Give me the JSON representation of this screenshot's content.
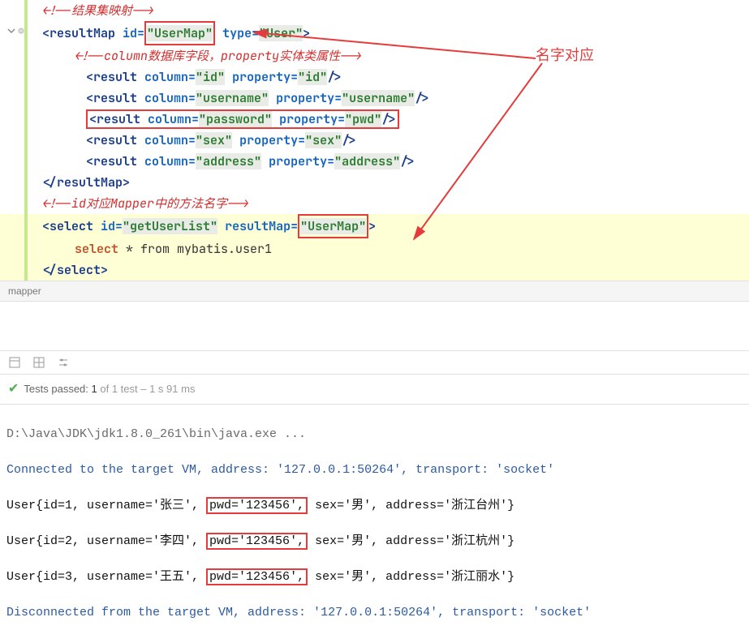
{
  "annotation_label": "名字对应",
  "code": {
    "c1": "<!--结果集映射-->",
    "rm_open1": "<",
    "rm_tag": "resultMap",
    "rm_id_attr": " id=",
    "rm_id_val": "\"UserMap\"",
    "rm_type_attr": " type=",
    "rm_type_val": "\"User\"",
    "rm_close": ">",
    "c2": "<!--column数据库字段，property实体类属性-->",
    "r_tag": "result",
    "col_attr": " column=",
    "prop_attr": " property=",
    "r1_col": "\"id\"",
    "r1_prop": "\"id\"",
    "r2_col": "\"username\"",
    "r2_prop": "\"username\"",
    "r3_col": "\"password\"",
    "r3_prop": "\"pwd\"",
    "r4_col": "\"sex\"",
    "r4_prop": "\"sex\"",
    "r5_col": "\"address\"",
    "r5_prop": "\"address\"",
    "self_close": "/>",
    "rm_end": "</resultMap>",
    "c3": "<!--id对应Mapper中的方法名字-->",
    "sel_tag": "select",
    "sel_id_attr": " id=",
    "sel_id_val": "\"getUserList\"",
    "sel_rm_attr": " resultMap=",
    "sel_rm_val": "\"UserMap\"",
    "sql_sel": "select",
    "sql_rest": " * from mybatis.user1",
    "sel_end": "</select>"
  },
  "breadcrumb": "mapper",
  "test": {
    "passed_label": "Tests passed:",
    "passed_count": "1",
    "of": " of 1 test",
    "time": " – 1 s 91 ms"
  },
  "console": {
    "l1": "D:\\Java\\JDK\\jdk1.8.0_261\\bin\\java.exe ...",
    "l2": "Connected to the target VM, address: '127.0.0.1:50264', transport: 'socket'",
    "l3a": "User{id=1, username='张三', ",
    "l3b": "pwd='123456',",
    "l3c": " sex='男', address='浙江台州'}",
    "l4a": "User{id=2, username='李四', ",
    "l4b": "pwd='123456',",
    "l4c": " sex='男', address='浙江杭州'}",
    "l5a": "User{id=3, username='王五', ",
    "l5b": "pwd='123456',",
    "l5c": " sex='男', address='浙江丽水'}",
    "l6": "Disconnected from the target VM, address: '127.0.0.1:50264', transport: 'socket'"
  }
}
